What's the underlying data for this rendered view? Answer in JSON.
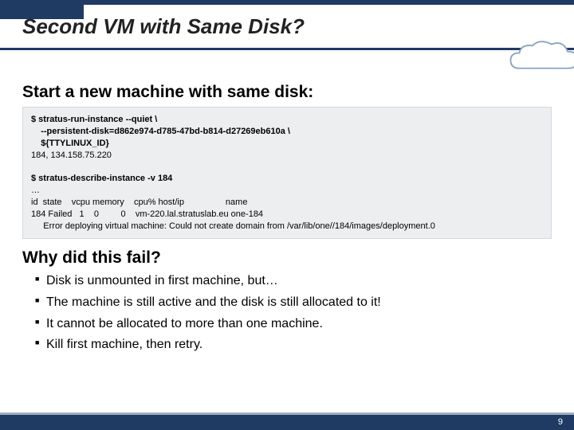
{
  "title": "Second VM with Same Disk?",
  "subhead": "Start a new machine with same disk:",
  "terminal": {
    "cmd1_l1": "$ stratus-run-instance --quiet \\",
    "cmd1_l2": "    --persistent-disk=d862e974-d785-47bd-b814-d27269eb610a \\",
    "cmd1_l3": "    ${TTYLINUX_ID}",
    "out1": "184, 134.158.75.220",
    "blank": "",
    "cmd2": "$ stratus-describe-instance -v 184",
    "out2_l1": "…",
    "out2_l2": "id  state    vcpu memory    cpu% host/ip                 name",
    "out2_l3": "184 Failed   1    0         0    vm-220.lal.stratuslab.eu one-184",
    "out2_l4": "     Error deploying virtual machine: Could not create domain from /var/lib/one//184/images/deployment.0"
  },
  "whyhead": "Why did this fail?",
  "bullets": [
    "Disk is unmounted in first machine, but…",
    "The machine is still active and the disk is still allocated to it!",
    "It cannot be allocated to more than one machine.",
    "Kill first machine, then retry."
  ],
  "pagenum": "9"
}
